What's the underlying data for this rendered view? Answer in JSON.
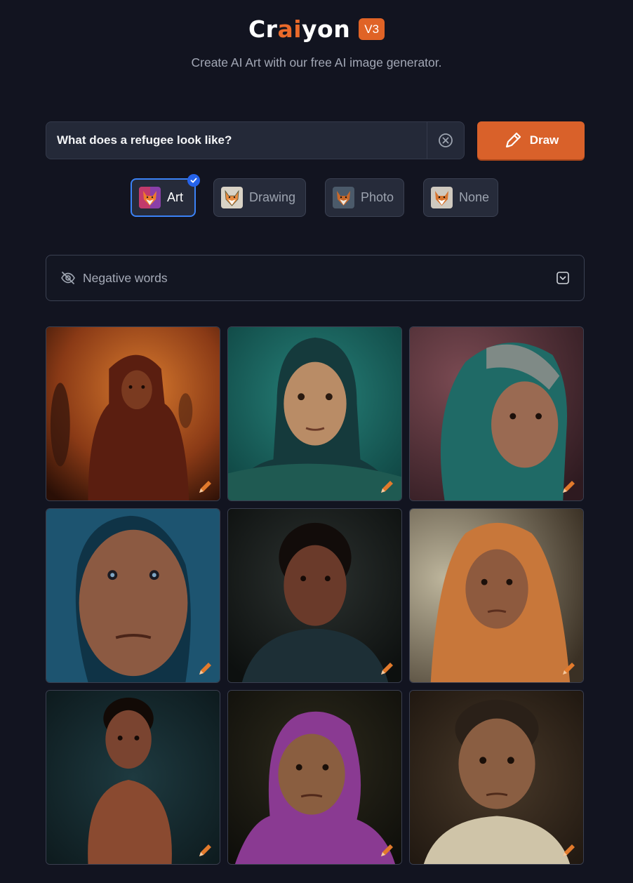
{
  "header": {
    "logo_prefix": "Cr",
    "logo_ai": "ai",
    "logo_suffix": "yon",
    "version": "V3",
    "subtitle": "Create AI Art with our free AI image generator."
  },
  "prompt": {
    "value": "What does a refugee look like?",
    "clear_icon": "clear-circle-icon",
    "draw_label": "Draw",
    "draw_icon": "pencil-icon"
  },
  "styles": [
    {
      "label": "Art",
      "selected": true
    },
    {
      "label": "Drawing",
      "selected": false
    },
    {
      "label": "Photo",
      "selected": false
    },
    {
      "label": "None",
      "selected": false
    }
  ],
  "negative": {
    "label": "Negative words",
    "icon": "eye-off-icon",
    "expand_icon": "chevron-down-icon"
  },
  "colors": {
    "accent": "#d9612a",
    "selected_border": "#3b82f6",
    "background": "#121420"
  },
  "images": [
    {
      "subject": "portrait-1",
      "edit_icon": "pencil-icon"
    },
    {
      "subject": "portrait-2",
      "edit_icon": "pencil-icon"
    },
    {
      "subject": "portrait-3",
      "edit_icon": "pencil-icon"
    },
    {
      "subject": "portrait-4",
      "edit_icon": "pencil-icon"
    },
    {
      "subject": "portrait-5",
      "edit_icon": "pencil-icon"
    },
    {
      "subject": "portrait-6",
      "edit_icon": "pencil-icon"
    },
    {
      "subject": "portrait-7",
      "edit_icon": "pencil-icon"
    },
    {
      "subject": "portrait-8",
      "edit_icon": "pencil-icon"
    },
    {
      "subject": "portrait-9",
      "edit_icon": "pencil-icon"
    }
  ]
}
